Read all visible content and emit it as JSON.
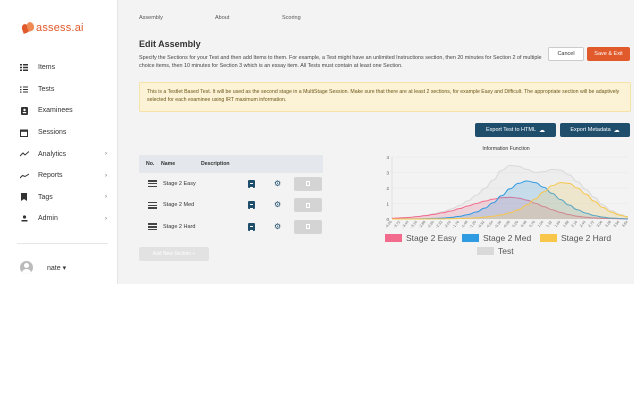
{
  "brand": {
    "name": "assess.ai",
    "accent": "#e05a2b"
  },
  "sidebar": {
    "items": [
      {
        "label": "Items",
        "icon": "list-icon",
        "has_children": false
      },
      {
        "label": "Tests",
        "icon": "checklist-icon",
        "has_children": false
      },
      {
        "label": "Examinees",
        "icon": "id-card-icon",
        "has_children": false
      },
      {
        "label": "Sessions",
        "icon": "calendar-icon",
        "has_children": false
      },
      {
        "label": "Analytics",
        "icon": "trend-icon",
        "has_children": true
      },
      {
        "label": "Reports",
        "icon": "chart-line-icon",
        "has_children": true
      },
      {
        "label": "Tags",
        "icon": "bookmark-icon",
        "has_children": true
      },
      {
        "label": "Admin",
        "icon": "user-admin-icon",
        "has_children": true
      }
    ],
    "chevron": "›",
    "user": {
      "name": "nate ▾"
    }
  },
  "topbar": {
    "tabs": [
      "Assembly",
      "About",
      "Scoring"
    ]
  },
  "page": {
    "title": "Edit Assembly",
    "description": "Specify the Sections for your Test and then add Items to them. For example, a Test might have an unlimited Instructions section, then 20 minutes for Section 2 of multiple choice items, then 10 minutes for Section 3 which is an essay item. All Tests must contain at least one Section.",
    "cancel_label": "Cancel",
    "save_label": "Save & Exit",
    "alert": "This is a Testlet Based Test. It will be used as the second stage in a MultiStage Session. Make sure that there are at least 2 sections, for example Easy and Difficult. The appropriate section will be adaptively selected for each examinee using IRT maximum information.",
    "export_html_label": "Export Test to HTML",
    "export_meta_label": "Export Metadata",
    "add_section_label": "Add New Section +"
  },
  "sections_table": {
    "columns": [
      "No.",
      "Name",
      "Description"
    ],
    "rows": [
      {
        "name": "Stage 2 Easy"
      },
      {
        "name": "Stage 2 Med"
      },
      {
        "name": "Stage 2 Hard"
      }
    ]
  },
  "chart_data": {
    "type": "line",
    "title": "Information Function",
    "ylim": [
      0,
      4
    ],
    "y_ticks": [
      0,
      1,
      2,
      3,
      4
    ],
    "x_ticks": [
      "-4.00",
      "-3.72",
      "-3.44",
      "-3.16",
      "-2.88",
      "-2.60",
      "-2.32",
      "-2.04",
      "-1.76",
      "-1.48",
      "-1.20",
      "-0.92",
      "-0.64",
      "-0.36",
      "-0.08",
      "0.20",
      "0.48",
      "0.76",
      "1.04",
      "1.32",
      "1.60",
      "1.88",
      "2.16",
      "2.44",
      "2.72",
      "3.00",
      "3.28",
      "3.56",
      "3.84"
    ],
    "legend_position": "bottom",
    "series": [
      {
        "name": "Stage 2 Easy",
        "color": "#f36b8c",
        "fill": "rgba(243,107,140,0.2)",
        "values": [
          0.05,
          0.07,
          0.1,
          0.15,
          0.22,
          0.3,
          0.4,
          0.52,
          0.67,
          0.84,
          1.0,
          1.15,
          1.28,
          1.37,
          1.4,
          1.35,
          1.22,
          1.02,
          0.8,
          0.6,
          0.42,
          0.28,
          0.18,
          0.11,
          0.07,
          0.04,
          0.03,
          0.02,
          0.01
        ]
      },
      {
        "name": "Stage 2 Med",
        "color": "#2f9be0",
        "fill": "rgba(47,155,224,0.2)",
        "values": [
          0.0,
          0.0,
          0.01,
          0.01,
          0.02,
          0.04,
          0.06,
          0.1,
          0.17,
          0.28,
          0.45,
          0.7,
          1.05,
          1.5,
          1.95,
          2.3,
          2.45,
          2.35,
          2.05,
          1.65,
          1.25,
          0.9,
          0.6,
          0.38,
          0.22,
          0.12,
          0.06,
          0.03,
          0.01
        ]
      },
      {
        "name": "Stage 2 Hard",
        "color": "#f7c64a",
        "fill": "rgba(247,198,74,0.2)",
        "values": [
          0.0,
          0.0,
          0.0,
          0.0,
          0.0,
          0.01,
          0.01,
          0.02,
          0.03,
          0.05,
          0.08,
          0.12,
          0.18,
          0.27,
          0.4,
          0.6,
          0.9,
          1.3,
          1.75,
          2.15,
          2.35,
          2.3,
          2.0,
          1.6,
          1.15,
          0.75,
          0.45,
          0.25,
          0.13
        ]
      },
      {
        "name": "Test",
        "color": "#d9d9d9",
        "fill": "rgba(217,217,217,0.2)",
        "values": [
          0.05,
          0.07,
          0.11,
          0.16,
          0.24,
          0.35,
          0.47,
          0.64,
          0.87,
          1.17,
          1.53,
          1.97,
          2.51,
          3.14,
          3.45,
          3.4,
          3.2,
          3.0,
          3.05,
          3.2,
          3.15,
          2.85,
          2.4,
          1.9,
          1.4,
          0.9,
          0.55,
          0.3,
          0.15
        ]
      }
    ]
  }
}
